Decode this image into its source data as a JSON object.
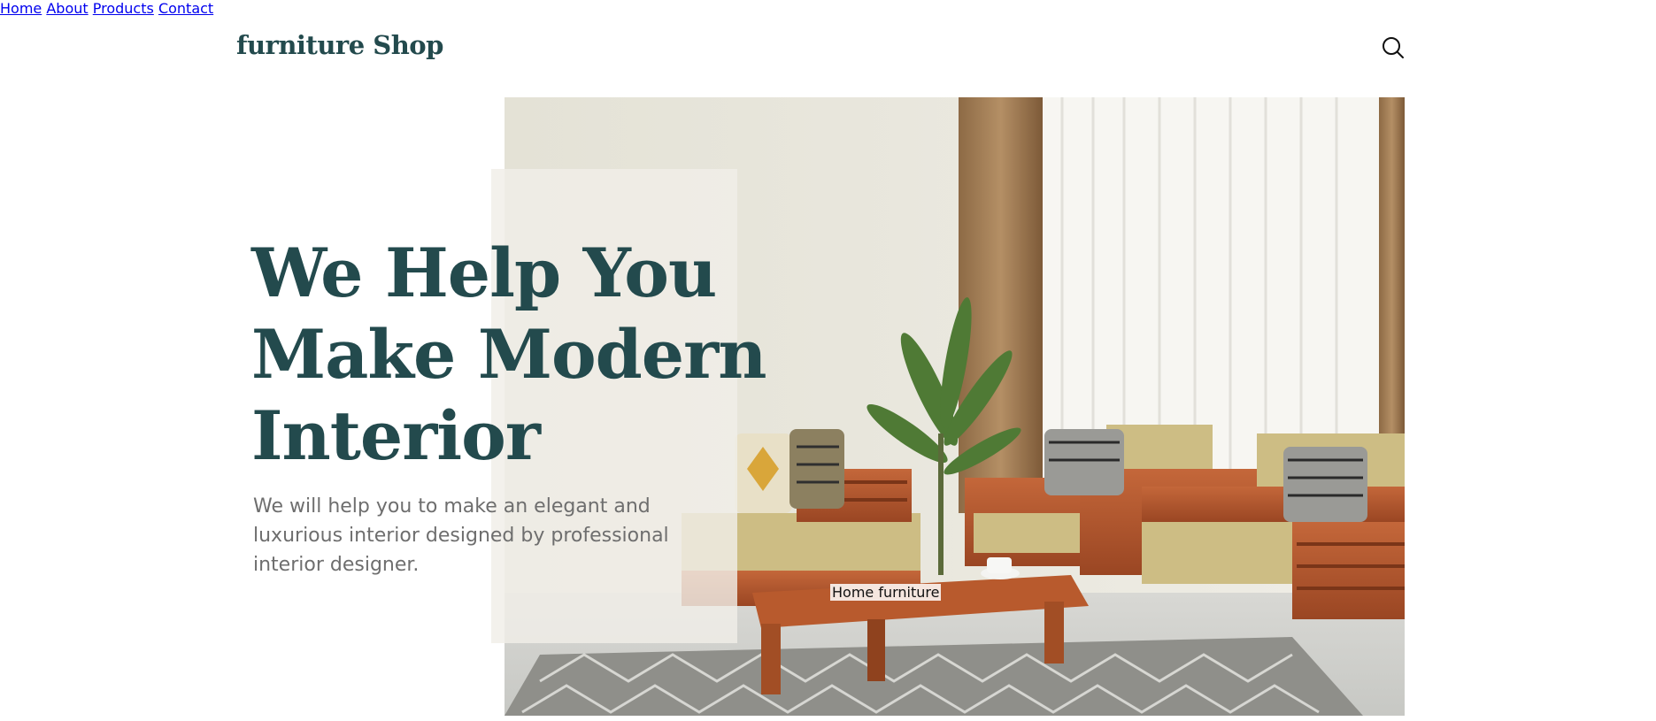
{
  "header": {
    "logo": "furniture Shop",
    "nav": [
      {
        "label": "Home"
      },
      {
        "label": "About"
      },
      {
        "label": "Products"
      },
      {
        "label": "Contact"
      }
    ],
    "search_icon": "search-icon"
  },
  "hero": {
    "headline_line1": "We Help You",
    "headline_line2": "Make Modern",
    "headline_line3": "Interior",
    "subtext": "We will help you to make an elegant and luxurious interior designed by professional interior designer.",
    "image_label": "Home furniture"
  },
  "colors": {
    "brand": "#234a4d",
    "subtext": "#6e6e6e",
    "wood": "#b5582c",
    "cushion": "#c9bb7f"
  }
}
